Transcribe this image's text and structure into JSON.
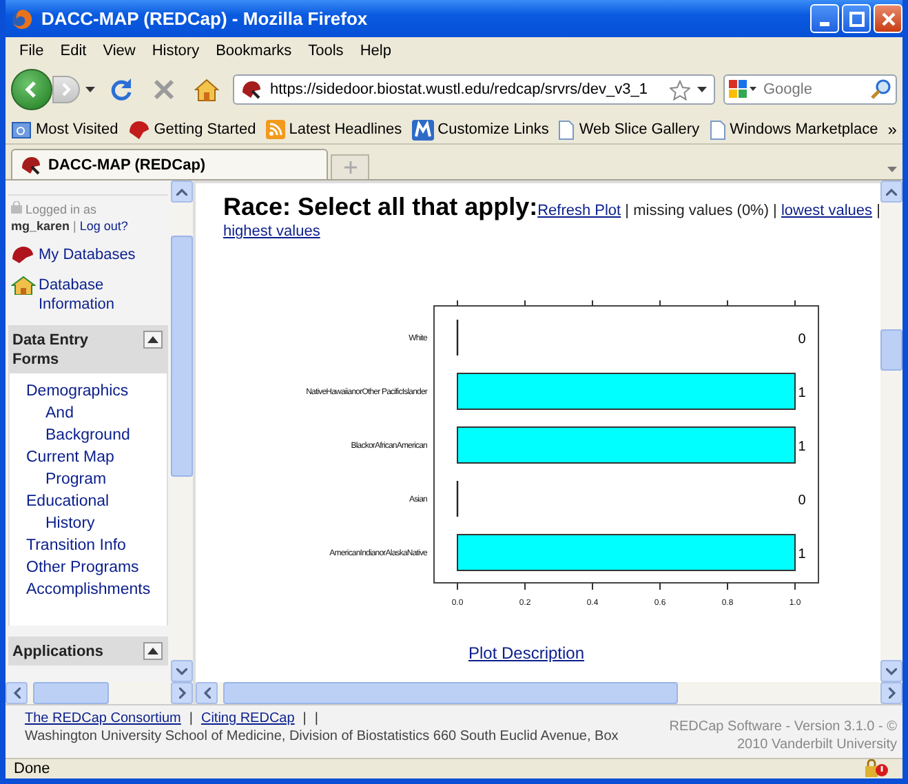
{
  "window": {
    "title": "DACC-MAP (REDCap) - Mozilla Firefox"
  },
  "menu": [
    "File",
    "Edit",
    "View",
    "History",
    "Bookmarks",
    "Tools",
    "Help"
  ],
  "address": {
    "value": "https://sidedoor.biostat.wustl.edu/redcap/srvrs/dev_v3_1"
  },
  "search": {
    "placeholder": "Google"
  },
  "bookmarks": [
    {
      "label": "Most Visited",
      "kind": "folder"
    },
    {
      "label": "Getting Started",
      "kind": "app"
    },
    {
      "label": "Latest Headlines",
      "kind": "feed"
    },
    {
      "label": "Customize Links",
      "kind": "tile"
    },
    {
      "label": "Web Slice Gallery",
      "kind": "page"
    },
    {
      "label": "Windows Marketplace",
      "kind": "page"
    }
  ],
  "bookmarks_overflow": "»",
  "tabs": [
    {
      "label": "DACC-MAP (REDCap)",
      "selected": true
    }
  ],
  "sidebar": {
    "logged_in": "Logged in as",
    "user": "mg_karen",
    "separator": "|",
    "logout": "Log out?",
    "links": [
      {
        "label": "My Databases",
        "kind": "cap"
      },
      {
        "label": "Database Information",
        "kind": "home"
      }
    ],
    "sections": [
      {
        "title": "Data Entry Forms",
        "expanded": true,
        "items": [
          "Demographics And Background",
          "Current Map Program",
          "Educational History",
          "Transition Info",
          "Other Programs",
          "Accomplishments"
        ]
      },
      {
        "title": "Applications",
        "expanded": true
      }
    ]
  },
  "main": {
    "heading": "Race: Select all that apply:",
    "line": [
      {
        "kind": "link",
        "text": "Refresh Plot"
      },
      {
        "kind": "text",
        "text": "| missing values (0%) |"
      },
      {
        "kind": "link",
        "text": "lowest values"
      },
      {
        "kind": "text",
        "text": "|"
      },
      {
        "kind": "link",
        "text": "highest values"
      }
    ],
    "chart_data": {
      "type": "bar",
      "orientation": "horizontal",
      "categories": [
        "White",
        "NativeHawaiianorOther PacificIslander",
        "BlackorAfricanAmerican",
        "Asian",
        "AmericanIndianorAlaskaNative"
      ],
      "series": [
        {
          "color": "#00ffff",
          "values": [
            0,
            1,
            1,
            0,
            1
          ]
        }
      ],
      "xlim": [
        0,
        1
      ],
      "xticks": [
        {
          "value": 0,
          "label": "0.0"
        },
        {
          "value": 0.2,
          "label": "0.2"
        },
        {
          "value": 0.4,
          "label": "0.4"
        },
        {
          "value": 0.6,
          "label": "0.6"
        },
        {
          "value": 0.8,
          "label": "0.8"
        },
        {
          "value": 1,
          "label": "1.0"
        }
      ],
      "data_labels": true
    },
    "plot_link": "Plot Description"
  },
  "footer": {
    "links": [
      "The REDCap Consortium",
      "Citing REDCap"
    ],
    "separators": [
      "|",
      "|",
      "|"
    ],
    "address": "Washington University School of Medicine, Division of Biostatistics 660 South Euclid Avenue, Box",
    "version": [
      "REDCap Software - Version 3.1.0 - ©",
      "2010 Vanderbilt University"
    ]
  },
  "status": {
    "text": "Done"
  }
}
